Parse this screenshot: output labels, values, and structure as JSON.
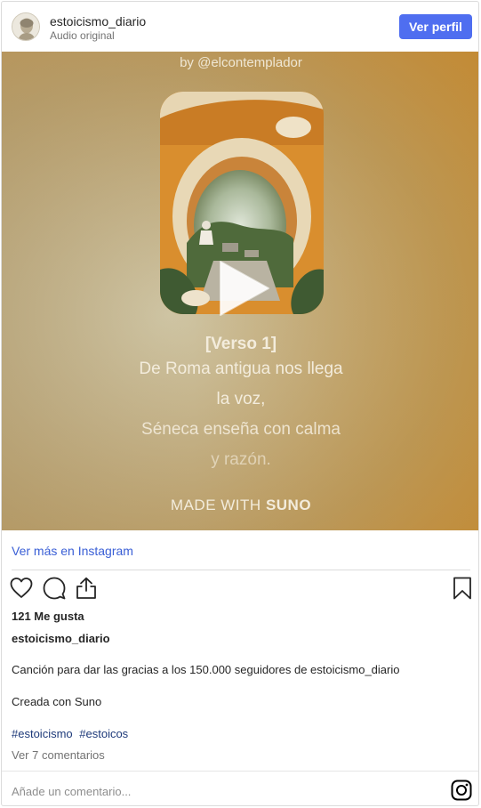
{
  "header": {
    "username": "estoicismo_diario",
    "subtitle": "Audio original",
    "profile_button": "Ver perfil"
  },
  "media": {
    "byline": "by @elcontemplador",
    "verse_title": "[Verso 1]",
    "verse_lines": [
      "De Roma antigua nos llega",
      "la voz,",
      "Séneca enseña con calma",
      "y razón."
    ],
    "made_with_prefix": "MADE WITH",
    "made_with_brand": "SUNO",
    "play_icon": "play-icon"
  },
  "links": {
    "view_more": "Ver más en Instagram"
  },
  "actions": {
    "icons": [
      "heart-icon",
      "comment-icon",
      "share-icon",
      "bookmark-icon"
    ]
  },
  "post": {
    "likes": "121 Me gusta",
    "owner": "estoicismo_diario",
    "caption": "Canción para dar las gracias a los 150.000 seguidores de estoicismo_diario",
    "caption2": "Creada con Suno",
    "hashtags": [
      "#estoicismo",
      "#estoicos"
    ],
    "comments_link": "Ver 7 comentarios"
  },
  "comment_box": {
    "placeholder": "Añade un comentario..."
  },
  "colors": {
    "accent_button": "#4f6ef0",
    "link_blue": "#3a5fd6",
    "hashtag": "#1e3a7a"
  }
}
